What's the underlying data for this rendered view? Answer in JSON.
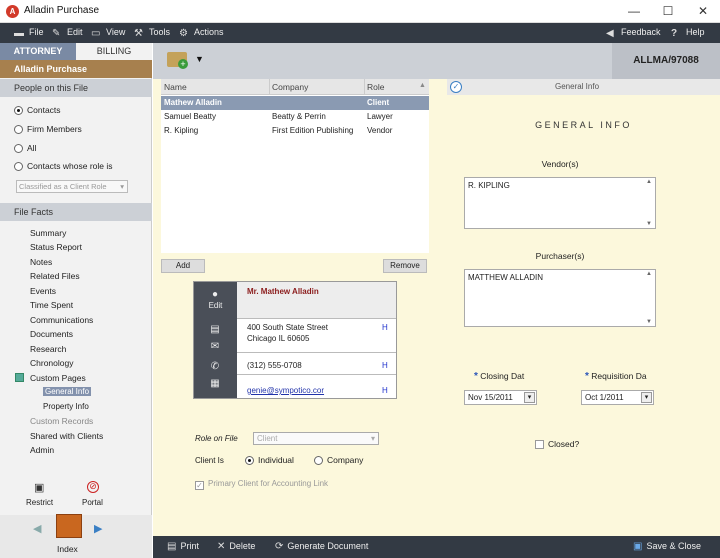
{
  "window": {
    "title": "Alladin Purchase",
    "minimize": "—",
    "maximize": "☐",
    "close": "✕"
  },
  "menubar": {
    "items": [
      {
        "label": "File",
        "icon": "folder-icon"
      },
      {
        "label": "Edit",
        "icon": "edit-icon"
      },
      {
        "label": "View",
        "icon": "monitor-icon"
      },
      {
        "label": "Tools",
        "icon": "wrench-icon"
      },
      {
        "label": "Actions",
        "icon": "gear-icon"
      }
    ],
    "feedback": "Feedback",
    "help": "Help"
  },
  "sidebar": {
    "tabs": {
      "attorney": "ATTORNEY",
      "billing": "BILLING"
    },
    "file_name": "Alladin Purchase",
    "people_heading": "People on this File",
    "people_options": [
      {
        "label": "Contacts",
        "selected": true
      },
      {
        "label": "Firm Members",
        "selected": false
      },
      {
        "label": "All",
        "selected": false
      },
      {
        "label": "Contacts whose role is",
        "selected": false
      }
    ],
    "role_filter": "Classified as a Client Role",
    "facts_heading": "File Facts",
    "facts": [
      "Summary",
      "Status Report",
      "Notes",
      "Related Files",
      "Events",
      "Time Spent",
      "Communications",
      "Documents",
      "Research",
      "Chronology",
      "Custom Pages"
    ],
    "custom_pages_children": [
      "General Info",
      "Property Info"
    ],
    "facts_after": [
      "Custom Records",
      "Shared with Clients",
      "Admin"
    ],
    "restrict": "Restrict",
    "portal": "Portal",
    "index": "Index"
  },
  "main": {
    "matter_id": "ALLMA/97088",
    "grid": {
      "columns": [
        "Name",
        "Company",
        "Role"
      ],
      "rows": [
        {
          "name": "Mathew Alladin",
          "company": "",
          "role": "Client"
        },
        {
          "name": "Samuel Beatty",
          "company": "Beatty & Perrin",
          "role": "Lawyer"
        },
        {
          "name": "R. Kipling",
          "company": "First Edition Publishing",
          "role": "Vendor"
        }
      ]
    },
    "add": "Add",
    "remove": "Remove",
    "card": {
      "edit": "Edit",
      "name": "Mr. Mathew Alladin",
      "address1": "400 South State Street",
      "address2": "Chicago IL 60605",
      "phone": "(312) 555-0708",
      "email": "genie@sympotico.cor",
      "h": "H"
    },
    "role_on_file_label": "Role on File",
    "role_on_file_value": "Client",
    "client_is_label": "Client Is",
    "client_is_options": [
      {
        "label": "Individual",
        "selected": true
      },
      {
        "label": "Company",
        "selected": false
      }
    ],
    "primary_client": "Primary Client for Accounting Link"
  },
  "general_info": {
    "tab_label": "General Info",
    "title": "GENERAL INFO",
    "vendor_label": "Vendor(s)",
    "vendor_value": "R. KIPLING",
    "purchaser_label": "Purchaser(s)",
    "purchaser_value": "MATTHEW ALLADIN",
    "closing_label": "Closing Dat",
    "closing_value": "Nov 15/2011",
    "requisition_label": "Requisition Da",
    "requisition_value": "Oct 1/2011",
    "closed_label": "Closed?"
  },
  "bottom": {
    "print": "Print",
    "delete": "Delete",
    "generate": "Generate Document",
    "save_close": "Save & Close"
  }
}
